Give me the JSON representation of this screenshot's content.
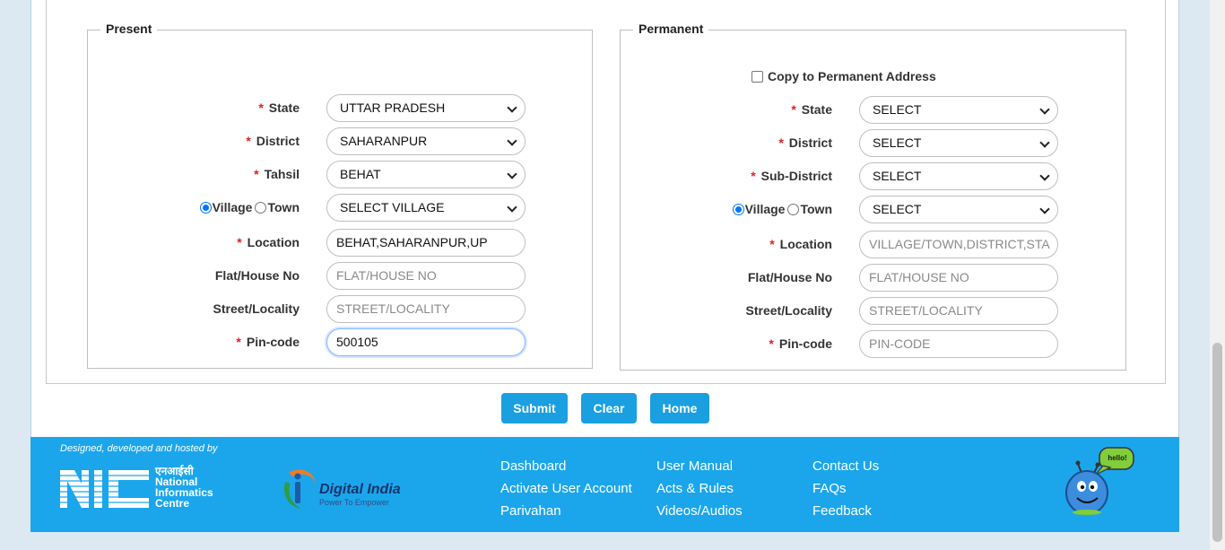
{
  "present": {
    "legend": "Present",
    "state": {
      "label": "State",
      "value": "UTTAR PRADESH"
    },
    "district": {
      "label": "District",
      "value": "SAHARANPUR"
    },
    "tahsil": {
      "label": "Tahsil",
      "value": "BEHAT"
    },
    "village_radio": "Village",
    "town_radio": "Town",
    "village_select": "SELECT VILLAGE",
    "location": {
      "label": "Location",
      "value": "BEHAT,SAHARANPUR,UP"
    },
    "flat": {
      "label": "Flat/House No",
      "placeholder": "FLAT/HOUSE NO"
    },
    "street": {
      "label": "Street/Locality",
      "placeholder": "STREET/LOCALITY"
    },
    "pincode": {
      "label": "Pin-code",
      "value": "500105"
    }
  },
  "permanent": {
    "legend": "Permanent",
    "copy_label": "Copy to Permanent Address",
    "state": {
      "label": "State",
      "value": "SELECT"
    },
    "district": {
      "label": "District",
      "value": "SELECT"
    },
    "subdistrict": {
      "label": "Sub-District",
      "value": "SELECT"
    },
    "village_radio": "Village",
    "town_radio": "Town",
    "village_select": "SELECT",
    "location": {
      "label": "Location",
      "placeholder": "VILLAGE/TOWN,DISTRICT,STA"
    },
    "flat": {
      "label": "Flat/House No",
      "placeholder": "FLAT/HOUSE NO"
    },
    "street": {
      "label": "Street/Locality",
      "placeholder": "STREET/LOCALITY"
    },
    "pincode": {
      "label": "Pin-code",
      "placeholder": "PIN-CODE"
    }
  },
  "required_mark": "*",
  "buttons": {
    "submit": "Submit",
    "clear": "Clear",
    "home": "Home"
  },
  "footer": {
    "designed_by": "Designed, developed and hosted by",
    "nic_hindi": "एनआईसी",
    "nic_line1": "National",
    "nic_line2": "Informatics",
    "nic_line3": "Centre",
    "digital_india": "Digital India",
    "digital_india_tag": "Power To Empower",
    "links_col1": [
      "Dashboard",
      "Activate User Account",
      "Parivahan"
    ],
    "links_col2": [
      "User Manual",
      "Acts & Rules",
      "Videos/Audios"
    ],
    "links_col3": [
      "Contact Us",
      "FAQs",
      "Feedback"
    ],
    "mascot_bubble": "hello!"
  },
  "colors": {
    "accent": "#1a9fe0",
    "footer_bg": "#1ba6ec",
    "required": "#e0201d"
  }
}
